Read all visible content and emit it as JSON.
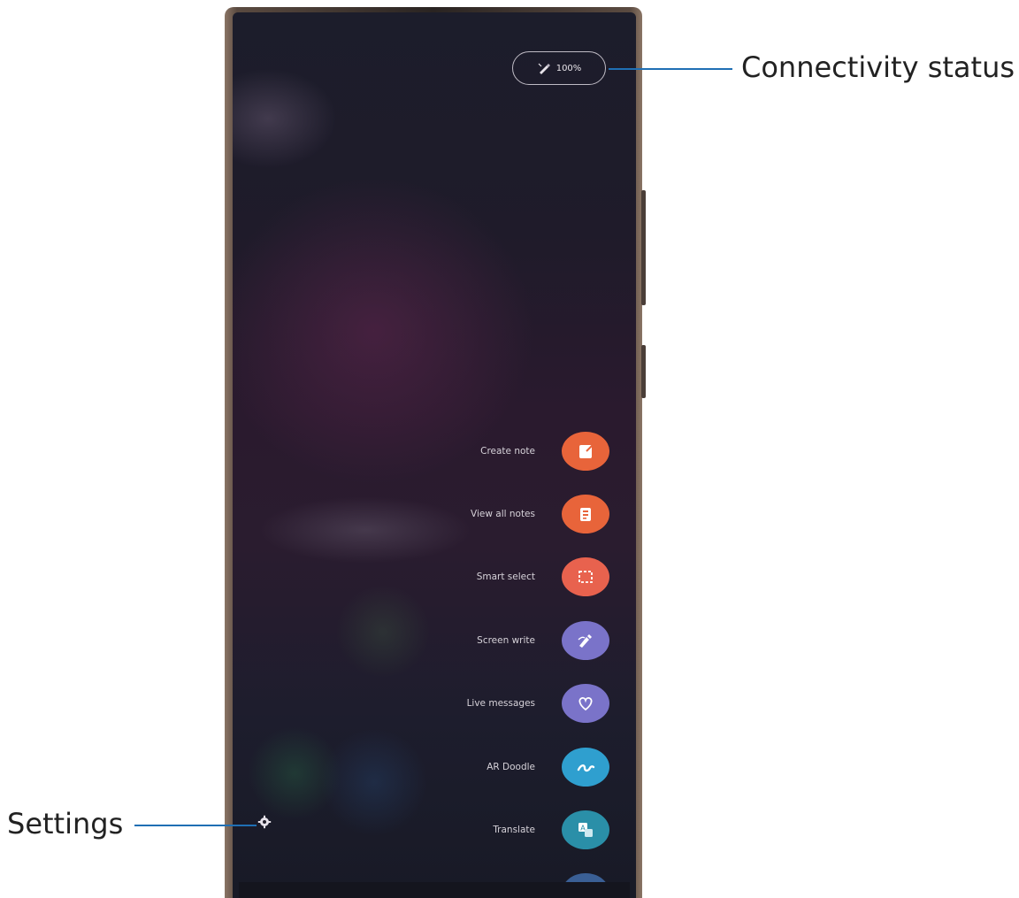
{
  "status": {
    "battery": "100%",
    "icon": "pen-icon"
  },
  "menu": [
    {
      "label": "Create note",
      "icon": "create-note-icon",
      "color": "#e8643a"
    },
    {
      "label": "View all notes",
      "icon": "view-all-notes-icon",
      "color": "#e8643a"
    },
    {
      "label": "Smart select",
      "icon": "smart-select-icon",
      "color": "#e8624e"
    },
    {
      "label": "Screen write",
      "icon": "screen-write-icon",
      "color": "#7a73c9"
    },
    {
      "label": "Live messages",
      "icon": "live-messages-icon",
      "color": "#7a73c9"
    },
    {
      "label": "AR Doodle",
      "icon": "ar-doodle-icon",
      "color": "#2f9fcf"
    },
    {
      "label": "Translate",
      "icon": "translate-icon",
      "color": "#2a8fa8"
    }
  ],
  "settings_icon": "gear-icon",
  "callouts": {
    "connectivity": "Connectivity status",
    "settings": "Settings"
  }
}
